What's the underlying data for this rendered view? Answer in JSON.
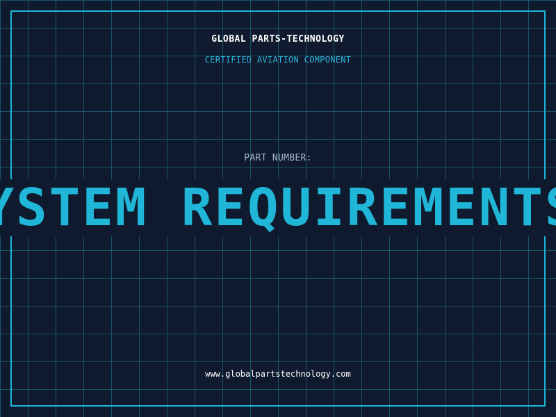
{
  "header": {
    "company": "GLOBAL PARTS-TECHNOLOGY",
    "tagline": "CERTIFIED AVIATION COMPONENT"
  },
  "part": {
    "label": "PART NUMBER:",
    "value": "SYSTEM REQUIREMENTS R"
  },
  "footer": {
    "url": "www.globalpartstechnology.com"
  },
  "colors": {
    "background": "#101a2e",
    "grid": "#2082a0",
    "accent": "#1fb6d8",
    "label": "#aab4c8",
    "text": "#ffffff"
  }
}
